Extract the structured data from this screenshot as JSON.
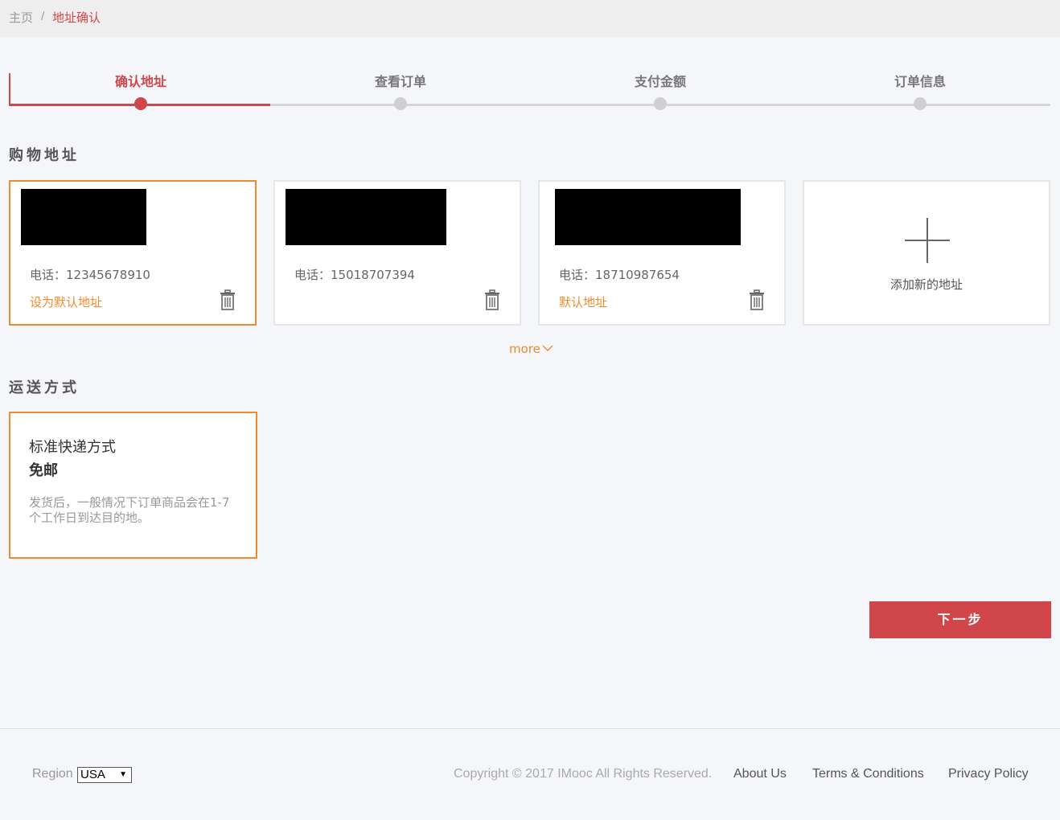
{
  "breadcrumb": {
    "home": "主页",
    "separator": "/",
    "current": "地址确认"
  },
  "steps": [
    {
      "label": "确认地址",
      "active": true
    },
    {
      "label": "查看订单",
      "active": false
    },
    {
      "label": "支付金额",
      "active": false
    },
    {
      "label": "订单信息",
      "active": false
    }
  ],
  "address_section": {
    "title": "购物地址",
    "cards": [
      {
        "phone": "电话：12345678910",
        "action": "设为默认地址",
        "selected": true
      },
      {
        "phone": "电话：15018707394",
        "action": "",
        "selected": false
      },
      {
        "phone": "电话：18710987654",
        "action": "默认地址",
        "selected": false
      }
    ],
    "add_label": "添加新的地址",
    "more": "more"
  },
  "shipping_section": {
    "title": "运送方式",
    "method": "标准快递方式",
    "price": "免邮",
    "description": "发货后，一般情况下订单商品会在1-7个工作日到达目的地。"
  },
  "next_button": "下一步",
  "footer": {
    "region_label": "Region",
    "region_value": "USA",
    "copyright": "Copyright © 2017 IMooc All Rights Reserved.",
    "links": [
      "About Us",
      "Terms & Conditions",
      "Privacy Policy"
    ]
  },
  "colors": {
    "accent": "#d1464b",
    "highlight": "#f08a2c",
    "inactive": "#cfcfcf"
  }
}
